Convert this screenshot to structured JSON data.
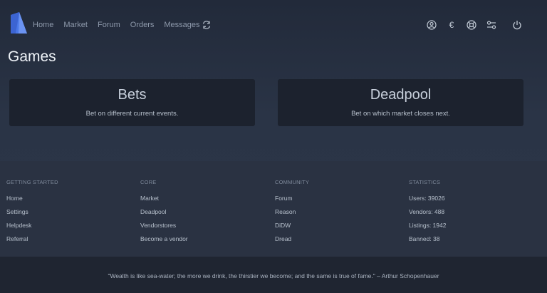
{
  "nav": {
    "items": [
      "Home",
      "Market",
      "Forum",
      "Orders",
      "Messages"
    ]
  },
  "header_icons": [
    "account-icon",
    "currency-euro-icon",
    "support-icon",
    "settings-sliders-icon",
    "power-icon"
  ],
  "header_icons_text": {
    "currency": "€"
  },
  "page": {
    "title": "Games"
  },
  "cards": [
    {
      "title": "Bets",
      "desc": "Bet on different current events."
    },
    {
      "title": "Deadpool",
      "desc": "Bet on which market closes next."
    }
  ],
  "footer": {
    "columns": [
      {
        "heading": "GETTING STARTED",
        "items": [
          "Home",
          "Settings",
          "Helpdesk",
          "Referral"
        ]
      },
      {
        "heading": "CORE",
        "items": [
          "Market",
          "Deadpool",
          "Vendorstores",
          "Become a vendor"
        ]
      },
      {
        "heading": "COMMUNITY",
        "items": [
          "Forum",
          "Reason",
          "DiDW",
          "Dread"
        ]
      },
      {
        "heading": "STATISTICS",
        "items": [
          "Users: 39026",
          "Vendors: 488",
          "Listings: 1942",
          "Banned: 38"
        ]
      }
    ]
  },
  "quote": "\"Wealth is like sea-water; the more we drink, the thirstier we become; and the same is true of fame.\" – Arthur Schopenhauer",
  "colors": {
    "accent": "#5b7cf0",
    "card_bg": "#1c222e",
    "footer_bg": "#2a3242",
    "quote_bg": "#1f2531"
  }
}
